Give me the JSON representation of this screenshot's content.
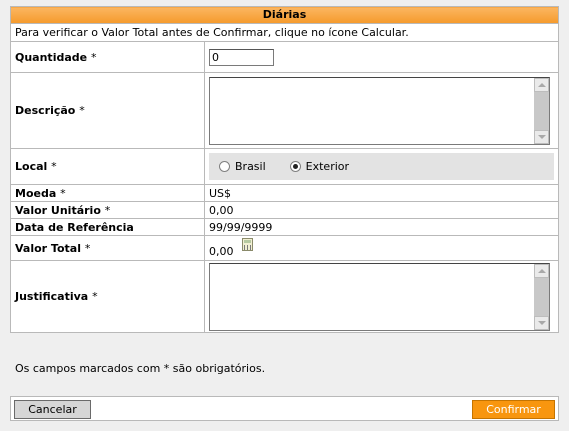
{
  "form": {
    "title": "Diárias",
    "info": "Para verificar o Valor Total antes de Confirmar, clique no ícone Calcular.",
    "quantidade": {
      "label": "Quantidade",
      "value": "0"
    },
    "descricao": {
      "label": "Descrição",
      "value": ""
    },
    "local": {
      "label": "Local",
      "options": [
        "Brasil",
        "Exterior"
      ],
      "selected": "Exterior"
    },
    "moeda": {
      "label": "Moeda",
      "value": "US$"
    },
    "valor_unitario": {
      "label": "Valor Unitário",
      "value": "0,00"
    },
    "data_referencia": {
      "label": "Data de Referência",
      "value": "99/99/9999"
    },
    "valor_total": {
      "label": "Valor Total",
      "value": "0,00",
      "icon": "calculator-icon"
    },
    "justificativa": {
      "label": "Justificativa",
      "value": ""
    },
    "required_mark": "*"
  },
  "footnote": "Os campos marcados com * são obrigatórios.",
  "buttons": {
    "cancel": "Cancelar",
    "confirm": "Confirmar"
  },
  "colors": {
    "header": "#f7a640",
    "confirm": "#f8960f",
    "background": "#efefef"
  }
}
